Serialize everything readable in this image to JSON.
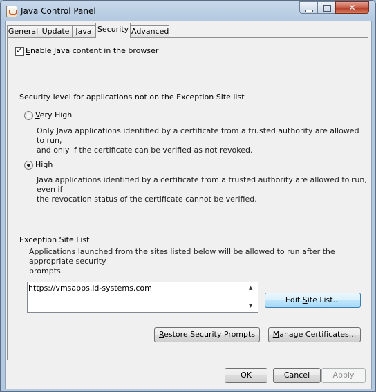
{
  "window": {
    "title": "Java Control Panel",
    "close_glyph": "✕"
  },
  "tabs": [
    {
      "label": "General"
    },
    {
      "label": "Update"
    },
    {
      "label": "Java"
    },
    {
      "label": "Security",
      "active": true
    },
    {
      "label": "Advanced"
    }
  ],
  "security": {
    "enable_java_label_mnemonic": "E",
    "enable_java_label_rest": "nable Java content in the browser",
    "enable_java_checked": true,
    "security_level_heading": "Security level for applications not on the Exception Site list",
    "levels": [
      {
        "mnemonic": "V",
        "label_rest": "ery High",
        "selected": false,
        "description_line1": "Only Java applications identified by a certificate from a trusted authority are allowed to run,",
        "description_line2": "and only if the certificate can be verified as not revoked."
      },
      {
        "mnemonic": "H",
        "label_rest": "igh",
        "selected": true,
        "description_line1": "Java applications identified by a certificate from a trusted authority are allowed to run, even if",
        "description_line2": "the revocation status of the certificate cannot be verified."
      }
    ],
    "exception_site": {
      "heading": "Exception Site List",
      "description_line1": "Applications launched from the sites listed below will be allowed to run after the appropriate security",
      "description_line2": "prompts.",
      "sites": [
        "https://vmsapps.id-systems.com"
      ],
      "edit_button_prefix": "Edit ",
      "edit_button_mnemonic": "S",
      "edit_button_rest": "ite List..."
    },
    "restore_button_mnemonic": "R",
    "restore_button_rest": "estore Security Prompts",
    "manage_button_mnemonic": "M",
    "manage_button_rest": "anage Certificates..."
  },
  "footer": {
    "ok_label": "OK",
    "cancel_label": "Cancel",
    "apply_label": "Apply"
  }
}
